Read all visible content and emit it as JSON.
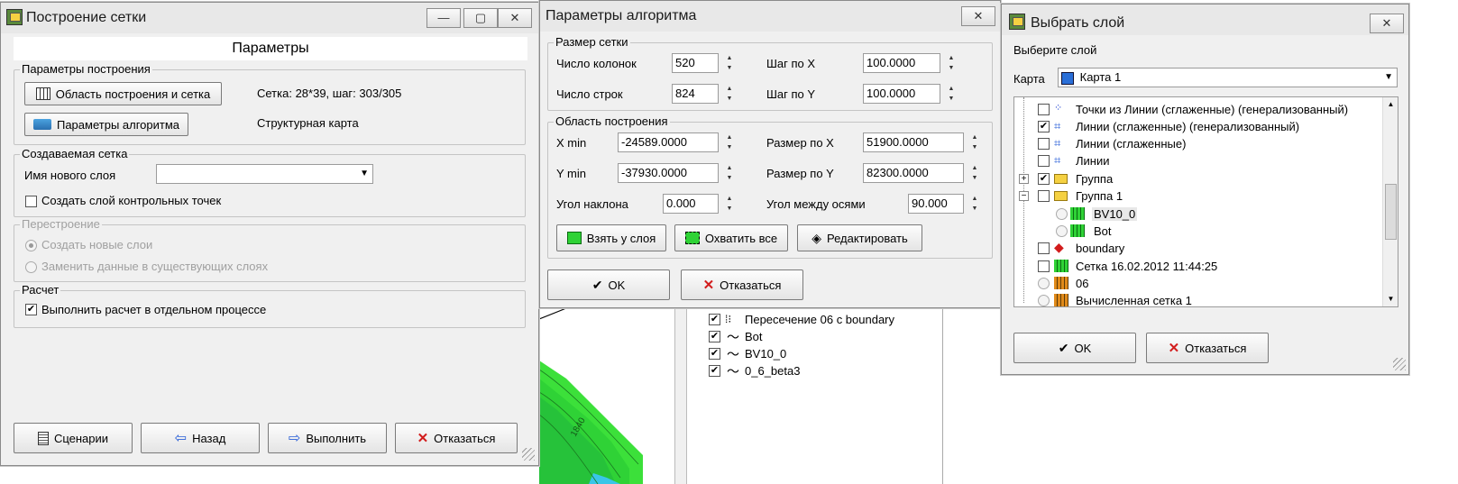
{
  "win1": {
    "title": "Построение сетки",
    "header": "Параметры",
    "build_params_group": "Параметры построения",
    "area_button": "Область построения и сетка",
    "grid_info": "Сетка: 28*39, шаг: 303/305",
    "algo_button": "Параметры алгоритма",
    "algo_info": "Структурная карта",
    "new_grid_group": "Создаваемая сетка",
    "new_layer_label": "Имя нового слоя",
    "new_layer_value": "",
    "control_points_label": "Создать слой контрольных точек",
    "control_points_checked": false,
    "rebuild_group": "Перестроение",
    "rebuild_option1": "Создать новые слои",
    "rebuild_option2": "Заменить данные в существующих слоях",
    "calc_group": "Расчет",
    "separate_process_label": "Выполнить расчет в отдельном процессе",
    "separate_process_checked": true,
    "btn_scenarios": "Сценарии",
    "btn_back": "Назад",
    "btn_run": "Выполнить",
    "btn_cancel": "Отказаться"
  },
  "win2": {
    "title": "Параметры алгоритма",
    "grid_size_group": "Размер сетки",
    "cols_label": "Число колонок",
    "cols_value": "520",
    "rows_label": "Число строк",
    "rows_value": "824",
    "stepx_label": "Шаг по X",
    "stepx_value": "100.0000",
    "stepy_label": "Шаг по Y",
    "stepy_value": "100.0000",
    "area_group": "Область построения",
    "xmin_label": "X min",
    "xmin_value": "-24589.0000",
    "ymin_label": "Y min",
    "ymin_value": "-37930.0000",
    "angle_label": "Угол наклона",
    "angle_value": "0.000",
    "sizex_label": "Размер по X",
    "sizex_value": "51900.0000",
    "sizey_label": "Размер по Y",
    "sizey_value": "82300.0000",
    "axes_angle_label": "Угол между осями",
    "axes_angle_value": "90.000",
    "btn_from_layer": "Взять у слоя",
    "btn_cover_all": "Охватить все",
    "btn_edit": "Редактировать",
    "btn_ok": "OK",
    "btn_cancel": "Отказаться"
  },
  "win3": {
    "title": "Выбрать слой",
    "prompt": "Выберите слой",
    "map_label": "Карта",
    "map_value": "Карта 1",
    "layers": [
      {
        "label": "Точки из Линии (сглаженные) (генерализованный)",
        "checked": false,
        "icon": "points-icon"
      },
      {
        "label": "Линии (сглаженные) (генерализованный)",
        "checked": true,
        "icon": "lines-icon"
      },
      {
        "label": "Линии (сглаженные)",
        "checked": false,
        "icon": "lines-icon"
      },
      {
        "label": "Линии",
        "checked": false,
        "icon": "lines-icon"
      },
      {
        "label": "Группа",
        "checked": true,
        "icon": "folder-icon"
      },
      {
        "label": "Группа 1",
        "checked": false,
        "icon": "folder-icon"
      },
      {
        "label": "BV10_0",
        "checked": false,
        "icon": "grid-icon"
      },
      {
        "label": "Bot",
        "checked": false,
        "icon": "grid-icon"
      },
      {
        "label": "boundary",
        "checked": false,
        "icon": "boundary-icon"
      },
      {
        "label": "Сетка 16.02.2012 11:44:25",
        "checked": false,
        "icon": "grid-icon"
      },
      {
        "label": "06",
        "checked": false,
        "icon": "grid-icon"
      },
      {
        "label": "Вычисленная сетка 1",
        "checked": false,
        "icon": "grid-icon"
      }
    ],
    "btn_ok": "OK",
    "btn_cancel": "Отказаться"
  },
  "background": {
    "layers": [
      {
        "label": "Пересечение 06 с boundary",
        "icon": "intersection-icon"
      },
      {
        "label": "Bot",
        "icon": "curve-icon"
      },
      {
        "label": "BV10_0",
        "icon": "curve-icon"
      },
      {
        "label": "0_6_beta3",
        "icon": "curve-icon"
      }
    ],
    "contour_label": "1840"
  }
}
